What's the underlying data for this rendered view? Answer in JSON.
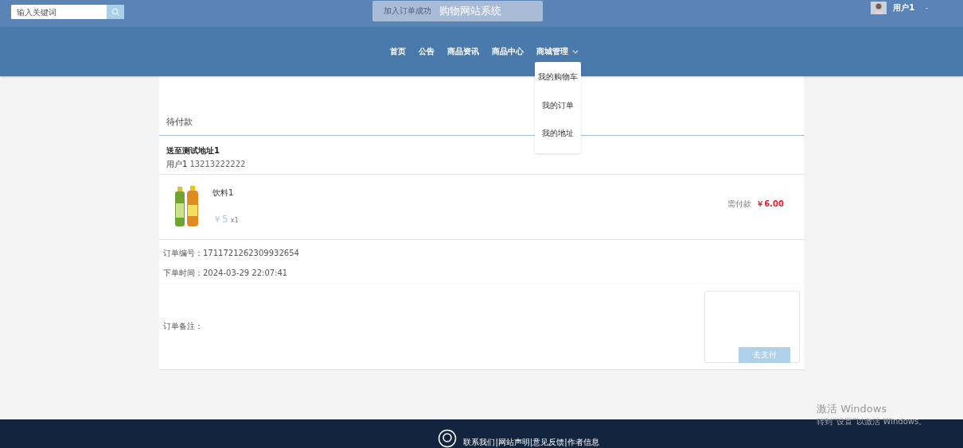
{
  "header": {
    "search": {
      "placeholder": "输入关键词"
    },
    "site_title": "购物网站系统",
    "toast": "加入订单成功",
    "user": {
      "name": "用户1",
      "caret": "-"
    }
  },
  "nav": {
    "items": [
      {
        "label": "首页",
        "dropdown": false
      },
      {
        "label": "公告",
        "dropdown": false
      },
      {
        "label": "商品资讯",
        "dropdown": false
      },
      {
        "label": "商品中心",
        "dropdown": false
      },
      {
        "label": "商城管理",
        "dropdown": true
      }
    ],
    "dropdown_menu": [
      "我的购物车",
      "我的订单",
      "我的地址"
    ]
  },
  "order": {
    "status": "待付款",
    "address": {
      "title": "送至测试地址1",
      "name": "用户1",
      "phone": "13213222222"
    },
    "items": [
      {
        "name": "饮料1",
        "price": "￥5",
        "quantity": "x1",
        "due_label": "需付款",
        "due_amount": "￥6.00"
      }
    ],
    "order_no": "订单编号：1711721262309932654",
    "order_time": "下单时间：2024-03-29 22:07:41",
    "remark_label": "订单备注：",
    "pay_button": "去支付"
  },
  "footer": {
    "links": "联系我们|网站声明|意见反馈|作者信息"
  },
  "os_overlay": {
    "title": "激活 Windows",
    "subtitle": "转到“设置”以激活 Windows。"
  }
}
